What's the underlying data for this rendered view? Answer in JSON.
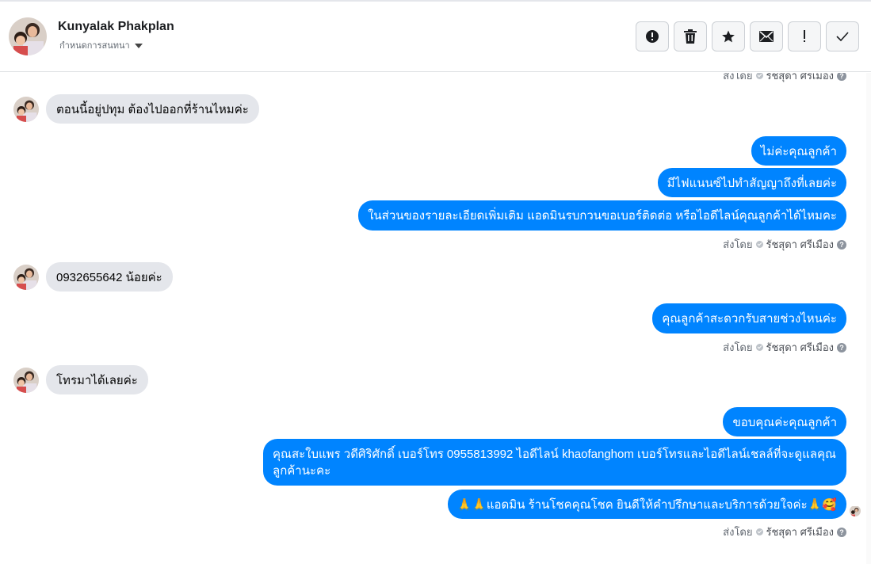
{
  "header": {
    "name": "Kunyalak Phakplan",
    "assign_label": "กำหนดการสนทนา"
  },
  "actions": [
    {
      "name": "report-spam-button",
      "icon": "alert-circle-icon"
    },
    {
      "name": "delete-button",
      "icon": "trash-icon"
    },
    {
      "name": "star-button",
      "icon": "star-icon"
    },
    {
      "name": "mark-unread-button",
      "icon": "envelope-icon"
    },
    {
      "name": "important-button",
      "icon": "exclamation-icon"
    },
    {
      "name": "mark-done-button",
      "icon": "check-icon"
    }
  ],
  "sent_by_label": "ส่งโดย",
  "agent_name": "รัชสุดา ศรีเมือง",
  "help_glyph": "?",
  "messages": {
    "in_1": "ตอนนี้อยู่ปทุม  ต้องไปออกที่ร้านไหมค่ะ",
    "out_1": "ไม่ค่ะคุณลูกค้า",
    "out_2": "มีไฟแนนซ์ไปทำสัญญาถึงที่เลยค่ะ",
    "out_3": "ในส่วนของรายละเอียดเพิ่มเติม แอดมินรบกวนขอเบอร์ติดต่อ หรือไอดีไลน์คุณลูกค้าได้ไหมคะ",
    "in_2": "0932655642  น้อยค่ะ",
    "out_4": "คุณลูกค้าสะดวกรับสายช่วงไหนค่ะ",
    "in_3": "โทรมาได้เลยค่ะ",
    "out_5": "ขอบคุณค่ะคุณลูกค้า",
    "out_6": "คุณสะใบแพร วดีศิริศักดิ์ เบอร์โทร 0955813992  ไอดีไลน์  khaofanghom  เบอร์โทรและไอดีไลน์เชลล์ที่จะดูแลคุณลูกค้านะคะ",
    "out_7": "🙏🙏แอดมิน ร้านโชคคุณโชค ยินดีให้คำปรึกษาและบริการด้วยใจค่ะ🙏🥰"
  },
  "colors": {
    "outgoing_bubble": "#0084ff",
    "incoming_bubble": "#e4e6eb"
  }
}
